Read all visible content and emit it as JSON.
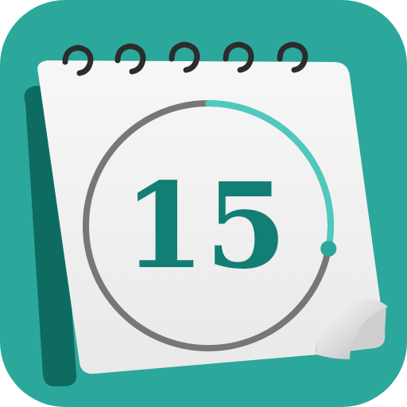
{
  "app_icon": {
    "type": "calendar-app-icon",
    "day_number": "15",
    "progress_fraction": 0.28,
    "colors": {
      "background": "#2ba89b",
      "page_shadow": "#0d6b62",
      "page": "#f1f1f1",
      "ring_track": "#777777",
      "ring_progress": "#4fc9bd",
      "number": "#137f74",
      "binder_rings": "#2c2c2c"
    },
    "icons": {
      "binder": "spiral-binding-icon",
      "page_curl": "page-curl-icon"
    }
  }
}
